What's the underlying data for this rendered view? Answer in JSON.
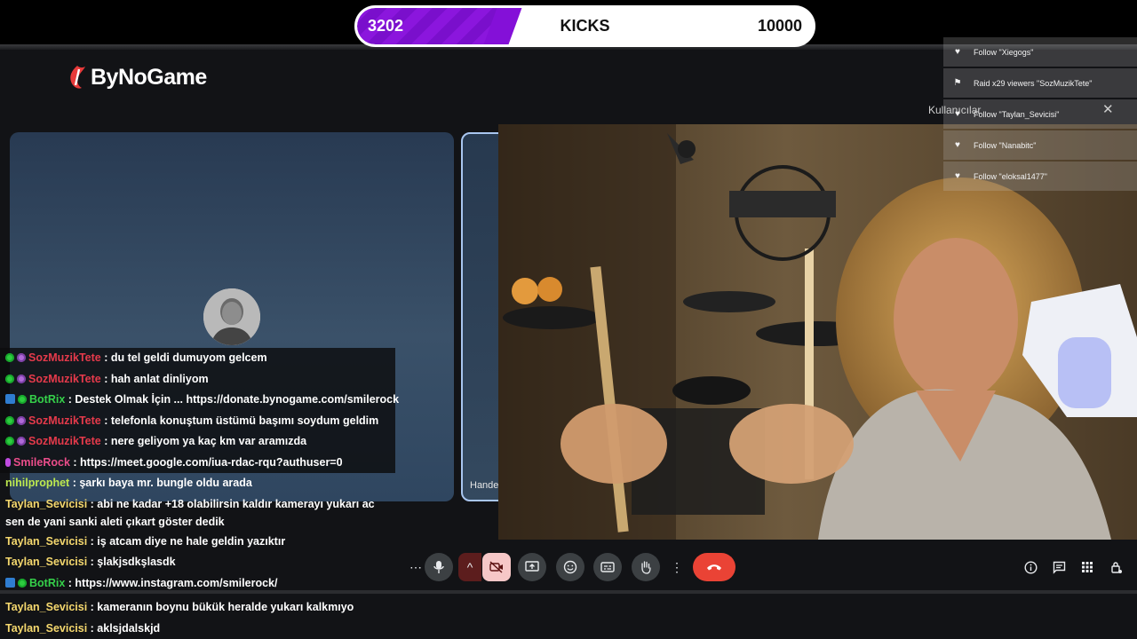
{
  "kicks": {
    "current": "3202",
    "label": "KICKS",
    "goal": "10000",
    "fill_fraction": 0.32
  },
  "logo": {
    "text": "ByNoGame"
  },
  "meet": {
    "participant_name_partial": "Hande",
    "panel_title_partial": "Kullanıcılar"
  },
  "alerts": [
    {
      "icon": "heart-icon",
      "text": "Follow \"Xiegogs\""
    },
    {
      "icon": "raid-icon",
      "text": "Raid x29 viewers \"SozMuzikTete\""
    },
    {
      "icon": "heart-icon",
      "text": "Follow \"Taylan_Sevicisi\""
    },
    {
      "icon": "heart-icon",
      "text": "Follow \"Nanabitc\""
    },
    {
      "icon": "heart-icon",
      "text": "Follow \"eloksal1477\""
    }
  ],
  "chat": [
    {
      "badges": [
        "green",
        "purple"
      ],
      "user": "SozMuzikTete",
      "color": "red",
      "text": "du tel geldi dumuyom gelcem"
    },
    {
      "badges": [
        "green",
        "purple"
      ],
      "user": "SozMuzikTete",
      "color": "red",
      "text": "hah anlat dinliyom"
    },
    {
      "badges": [
        "blue",
        "green"
      ],
      "user": "BotRix",
      "color": "green",
      "text": "Destek Olmak İçin ... https://donate.bynogame.com/smilerock"
    },
    {
      "badges": [
        "green",
        "purple"
      ],
      "user": "SozMuzikTete",
      "color": "red",
      "text": "telefonla konuştum üstümü başımı soydum geldim"
    },
    {
      "badges": [
        "green",
        "purple"
      ],
      "user": "SozMuzikTete",
      "color": "red",
      "text": "nere geliyom ya kaç km var aramızda"
    },
    {
      "badges": [
        "mic"
      ],
      "user": "SmileRock",
      "color": "pink",
      "text": "https://meet.google.com/iua-rdac-rqu?authuser=0"
    },
    {
      "badges": [],
      "user": "nihilprophet",
      "color": "lime",
      "text": "şarkı baya mr. bungle oldu arada"
    },
    {
      "badges": [],
      "user": "Taylan_Sevicisi",
      "color": "yellow",
      "text": "abi ne kadar +18 olabilirsin kaldır kamerayı yukarı ac sen de yani sanki aleti çıkart göster dedik",
      "wrap": true
    },
    {
      "badges": [],
      "user": "Taylan_Sevicisi",
      "color": "yellow",
      "text": "iş atcam diye ne hale geldin yazıktır"
    },
    {
      "badges": [],
      "user": "Taylan_Sevicisi",
      "color": "yellow",
      "text": "şlakjsdkşlasdk"
    },
    {
      "badges": [
        "blue",
        "green"
      ],
      "user": "BotRix",
      "color": "green",
      "text": "https://www.instagram.com/smilerock/"
    }
  ],
  "chat_bottom": [
    {
      "user": "Taylan_Sevicisi",
      "color": "yellow",
      "text": "kameranın boynu bükük heralde yukarı kalkmıyo"
    },
    {
      "user": "Taylan_Sevicisi",
      "color": "yellow",
      "text": "aklsjdalskjd"
    }
  ],
  "controls": {
    "left": [
      "more-icon",
      "mic-icon",
      "chevron-up-icon",
      "camera-off-icon",
      "present-icon",
      "emoji-icon",
      "captions-icon",
      "raise-hand-icon",
      "options-icon",
      "leave-call-icon"
    ],
    "right": [
      "info-icon",
      "chat-icon",
      "activities-icon",
      "host-controls-icon"
    ]
  }
}
